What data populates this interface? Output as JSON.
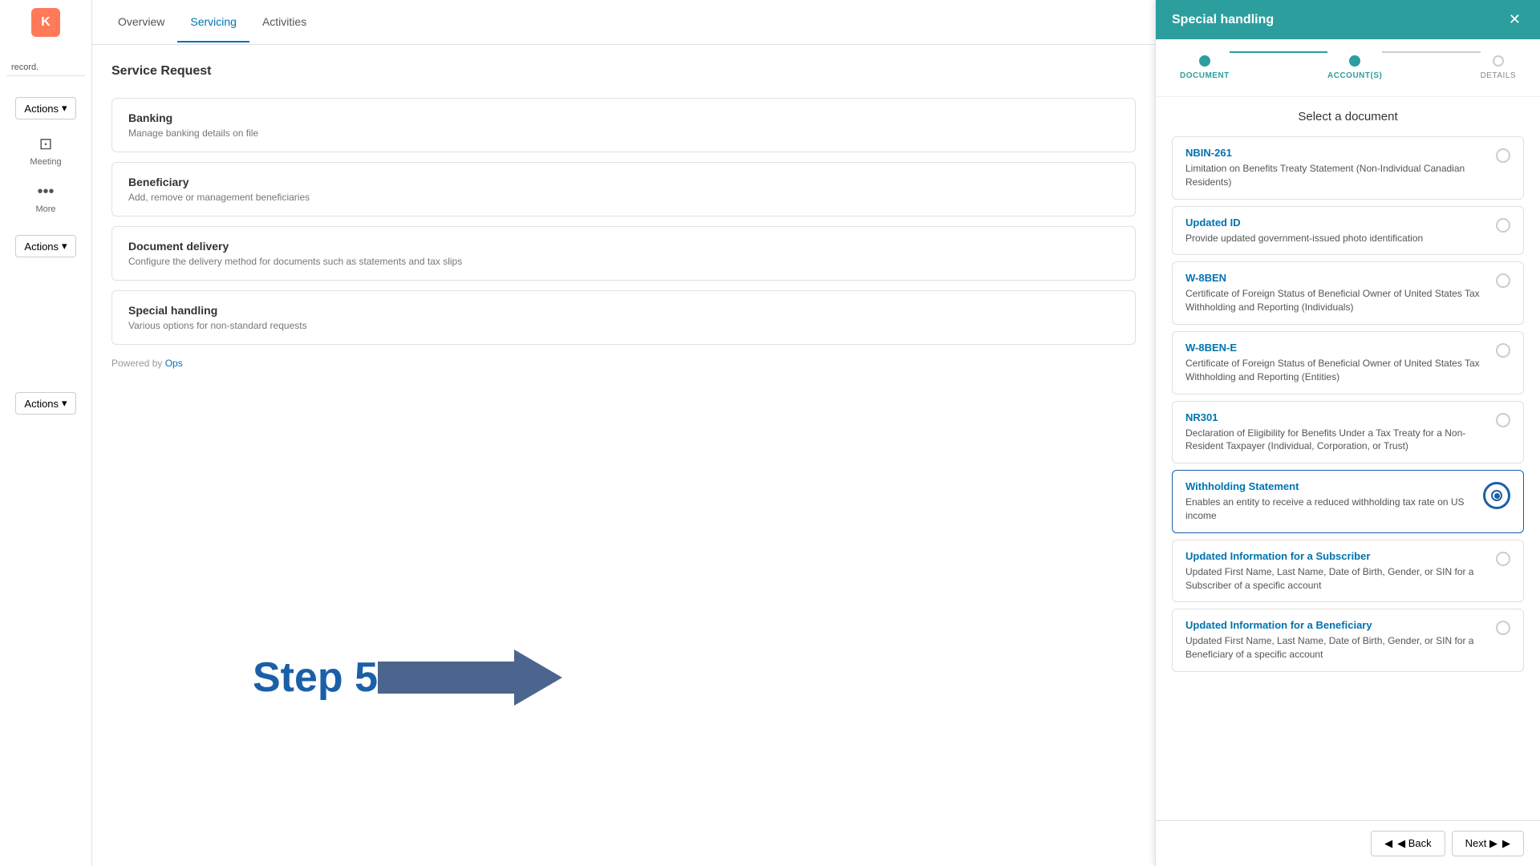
{
  "sidebar": {
    "logo_letter": "K",
    "actions_label": "Actions",
    "actions_labels_list": [
      "Actions",
      "Actions",
      "Actions"
    ],
    "meeting_label": "Meeting",
    "more_label": "More"
  },
  "tabs": {
    "overview": "Overview",
    "servicing": "Servicing",
    "activities": "Activities"
  },
  "service_request": {
    "title": "Service Request",
    "items": [
      {
        "title": "Banking",
        "desc": "Manage banking details on file"
      },
      {
        "title": "Beneficiary",
        "desc": "Add, remove or management beneficiaries"
      },
      {
        "title": "Document delivery",
        "desc": "Configure the delivery method for documents such as statements and tax slips"
      },
      {
        "title": "Special handling",
        "desc": "Various options for non-standard requests"
      }
    ],
    "powered_by": "Powered by",
    "ops_link": "Ops"
  },
  "step_overlay": {
    "text": "Step 5"
  },
  "special_handling": {
    "panel_title": "Special handling",
    "steps": [
      {
        "label": "DOCUMENT",
        "state": "completed"
      },
      {
        "label": "ACCOUNT(S)",
        "state": "active"
      },
      {
        "label": "DETAILS",
        "state": "inactive"
      }
    ],
    "section_title": "Select a document",
    "documents": [
      {
        "title": "NBIN-261",
        "desc": "Limitation on Benefits Treaty Statement (Non-Individual Canadian Residents)",
        "selected": false
      },
      {
        "title": "Updated ID",
        "desc": "Provide updated government-issued photo identification",
        "selected": false
      },
      {
        "title": "W-8BEN",
        "desc": "Certificate of Foreign Status of Beneficial Owner of United States Tax Withholding and Reporting (Individuals)",
        "selected": false
      },
      {
        "title": "W-8BEN-E",
        "desc": "Certificate of Foreign Status of Beneficial Owner of United States Tax Withholding and Reporting (Entities)",
        "selected": false
      },
      {
        "title": "NR301",
        "desc": "Declaration of Eligibility for Benefits Under a Tax Treaty for a Non-Resident Taxpayer (Individual, Corporation, or Trust)",
        "selected": false
      },
      {
        "title": "Withholding Statement",
        "desc": "Enables an entity to receive a reduced withholding tax rate on US income",
        "selected": true
      },
      {
        "title": "Updated Information for a Subscriber",
        "desc": "Updated First Name, Last Name, Date of Birth, Gender, or SIN for a Subscriber of a specific account",
        "selected": false
      },
      {
        "title": "Updated Information for a Beneficiary",
        "desc": "Updated First Name, Last Name, Date of Birth, Gender, or SIN for a Beneficiary of a specific account",
        "selected": false
      }
    ],
    "back_label": "◀ Back",
    "next_label": "Next ▶"
  },
  "record_text": "record."
}
